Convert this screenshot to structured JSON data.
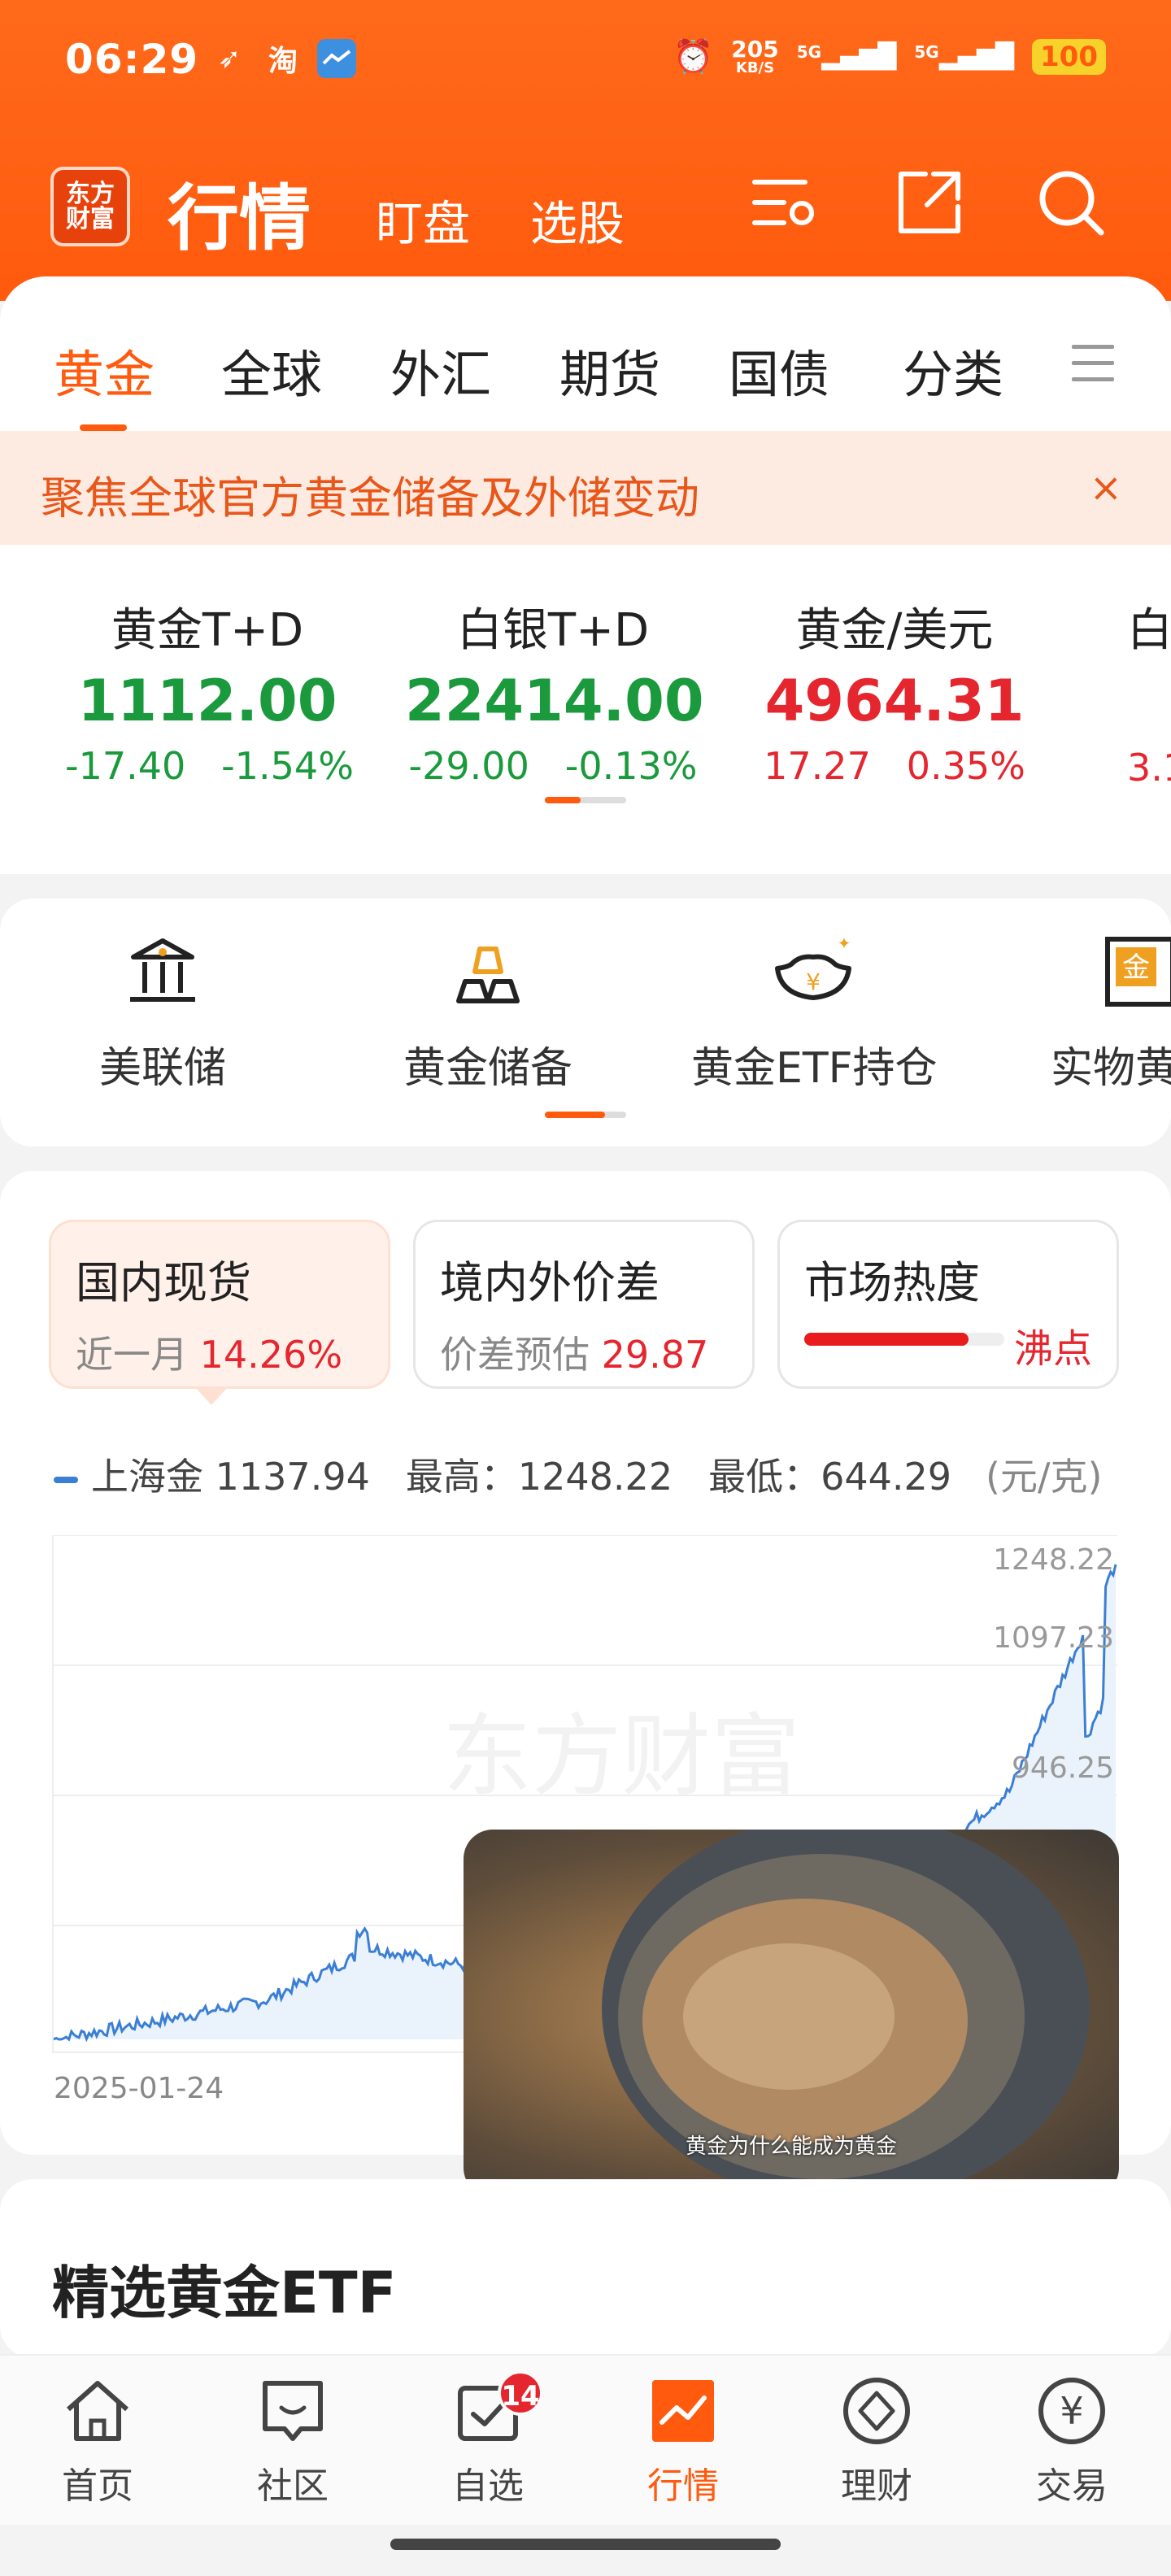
{
  "status_bar": {
    "time": "06:29",
    "net_speed_top": "205",
    "net_speed_unit": "KB/S",
    "signal1": "5G",
    "signal2": "5G",
    "battery": "100"
  },
  "header": {
    "logo_text": "东方财富",
    "title": "行情",
    "tabs": [
      "盯盘",
      "选股"
    ],
    "icons": [
      "settings-list-icon",
      "share-icon",
      "search-icon"
    ]
  },
  "categories": {
    "tabs": [
      "黄金",
      "全球",
      "外汇",
      "期货",
      "国债",
      "分类"
    ],
    "active": "黄金"
  },
  "banner": {
    "text": "聚焦全球官方黄金储备及外储变动",
    "close": "×"
  },
  "quotes": [
    {
      "name": "黄金T+D",
      "price": "1112.00",
      "change": "-17.40",
      "pct": "-1.54%",
      "dir": "down"
    },
    {
      "name": "白银T+D",
      "price": "22414.00",
      "change": "-29.00",
      "pct": "-0.13%",
      "dir": "down"
    },
    {
      "name": "黄金/美元",
      "price": "4964.31",
      "change": "17.27",
      "pct": "0.35%",
      "dir": "up"
    },
    {
      "name": "白",
      "price": "",
      "change": "3.1",
      "pct": "",
      "dir": "up"
    }
  ],
  "features": [
    "美联储",
    "黄金储备",
    "黄金ETF持仓",
    "实物黄"
  ],
  "market_tabs": [
    {
      "title": "国内现货",
      "sub_label": "近一月",
      "sub_value": "14.26%"
    },
    {
      "title": "境内外价差",
      "sub_label": "价差预估",
      "sub_value": "29.87"
    },
    {
      "title": "市场热度",
      "heat_level": 0.82,
      "heat_label": "沸点"
    }
  ],
  "chart_legend": {
    "series_name": "上海金",
    "last": "1137.94",
    "high_label": "最高：",
    "high": "1248.22",
    "low_label": "最低：",
    "low": "644.29",
    "unit": "(元/克)"
  },
  "chart_data": {
    "type": "area",
    "series": [
      {
        "name": "上海金",
        "color": "#3b7fd4"
      }
    ],
    "y_ticks": [
      "1248.22",
      "1097.23",
      "946.25"
    ],
    "x_start": "2025-01-24",
    "watermark": "东方财富",
    "x": [
      0,
      10,
      20,
      30,
      40,
      50,
      60,
      70,
      80,
      90,
      100
    ],
    "y": [
      644.29,
      668,
      694,
      760,
      735,
      748,
      742,
      790,
      850,
      960,
      1248.22
    ],
    "ylim": [
      644.29,
      1248.22
    ]
  },
  "video": {
    "caption": "黄金为什么能成为黄金"
  },
  "etf_section": {
    "title": "精选黄金ETF"
  },
  "bottom_nav": [
    {
      "label": "首页",
      "icon": "home-icon"
    },
    {
      "label": "社区",
      "icon": "chat-icon"
    },
    {
      "label": "自选",
      "icon": "watchlist-icon",
      "badge": "14"
    },
    {
      "label": "行情",
      "icon": "market-chart-icon",
      "active": true
    },
    {
      "label": "理财",
      "icon": "diamond-icon"
    },
    {
      "label": "交易",
      "icon": "yen-icon"
    }
  ]
}
